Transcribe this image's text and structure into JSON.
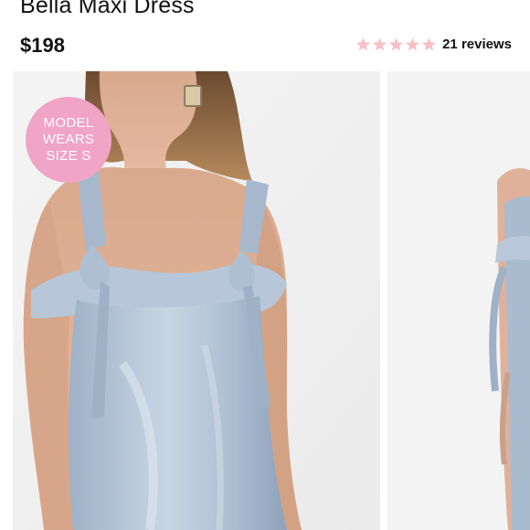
{
  "product": {
    "title": "Bella Maxi Dress",
    "price": "$198"
  },
  "rating": {
    "stars_filled": 0,
    "stars_total": 5,
    "reviews_label": "21 reviews",
    "star_color": "#f6c1c8"
  },
  "badge": {
    "line1": "MODEL",
    "line2": "WEARS",
    "line3": "SIZE S",
    "color": "#f0a4c6"
  },
  "gallery": {
    "images": [
      {
        "name": "main-photo"
      },
      {
        "name": "second-photo"
      }
    ]
  }
}
